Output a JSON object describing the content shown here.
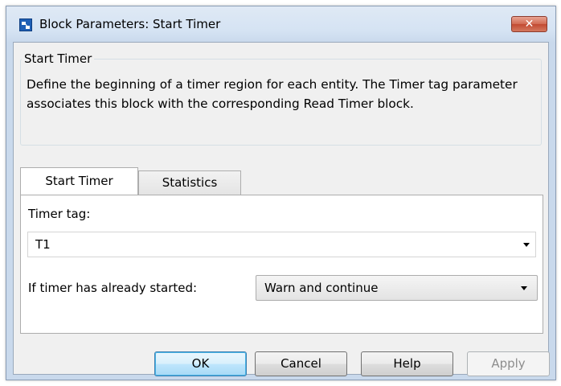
{
  "window": {
    "title": "Block Parameters: Start Timer",
    "close_glyph": "✕"
  },
  "group": {
    "title": "Start Timer",
    "description": "Define the beginning of a timer region for each entity. The Timer tag parameter associates this block with the corresponding Read Timer block."
  },
  "tabs": [
    {
      "label": "Start Timer",
      "active": true
    },
    {
      "label": "Statistics",
      "active": false
    }
  ],
  "timer_tag": {
    "label": "Timer tag:",
    "value": "T1"
  },
  "already_started": {
    "label": "If timer has already started:",
    "value": "Warn and continue"
  },
  "buttons": {
    "ok": "OK",
    "cancel": "Cancel",
    "help": "Help",
    "apply": "Apply"
  },
  "colors": {
    "close_button": "#c9533b",
    "ok_border": "#3c7fb1",
    "apply_disabled_text": "#8d8d8d"
  }
}
